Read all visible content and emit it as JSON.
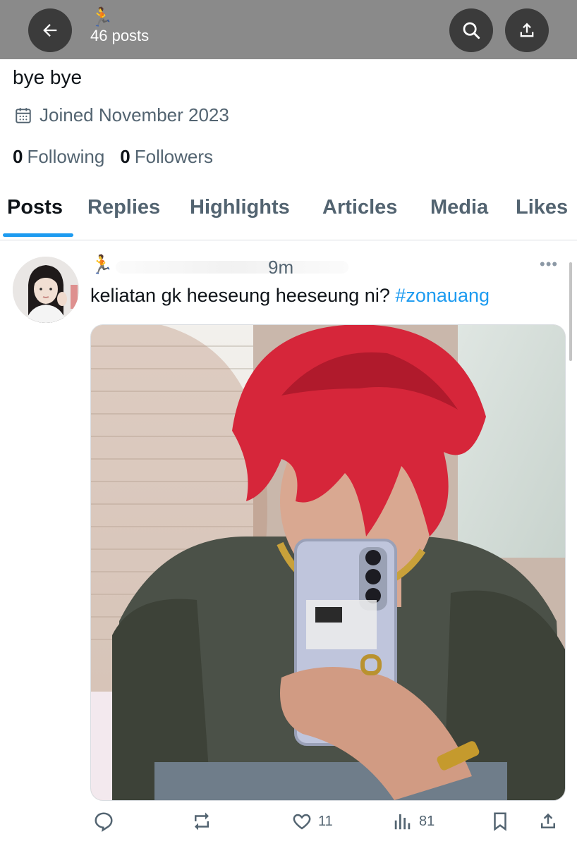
{
  "header": {
    "runner_emoji": "🏃",
    "post_count": "46 posts",
    "back_icon": "arrow-left-icon",
    "search_icon": "search-icon",
    "share_icon": "upload-icon"
  },
  "profile": {
    "bio": "bye bye",
    "joined": "Joined November 2023",
    "following_count": "0",
    "following_label": "Following",
    "followers_count": "0",
    "followers_label": "Followers"
  },
  "tabs": [
    {
      "label": "Posts",
      "active": true
    },
    {
      "label": "Replies"
    },
    {
      "label": "Highlights"
    },
    {
      "label": "Articles"
    },
    {
      "label": "Media"
    },
    {
      "label": "Likes"
    }
  ],
  "post": {
    "runner_emoji": "🏃",
    "time": "9m",
    "text": "keliatan gk heeseung heeseung ni?",
    "hashtag": "#zonauang",
    "likes": "11",
    "views": "81"
  },
  "colors": {
    "accent": "#1d9bf0",
    "header_bg": "#8a8a8a",
    "secondary_text": "#536471"
  }
}
